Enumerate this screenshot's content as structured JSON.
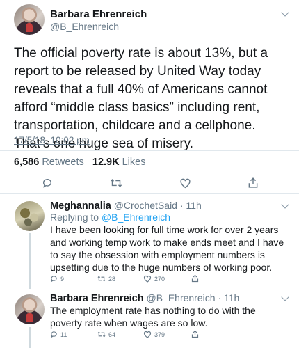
{
  "main_tweet": {
    "author_name": "Barbara Ehrenreich",
    "author_handle": "@B_Ehrenreich",
    "text": "The official poverty rate is about 13%, but a report to be released by United Way today reveals that a full 40% of Americans cannot afford “middle class basics” including rent, transportation, childcare and a cellphone. That’s one huge sea of misery.",
    "timestamp": "17/5/18, 10:02 pm",
    "retweets_count": "6,586",
    "retweets_label": "Retweets",
    "likes_count": "12.9K",
    "likes_label": "Likes"
  },
  "replies": [
    {
      "author_name": "Meghannalia",
      "author_handle": "@CrochetSaid",
      "time": "· 11h",
      "replying_prefix": "Replying to",
      "replying_to": "@B_Ehrenreich",
      "text": "I have been looking for full time work for over 2 years and working temp work to make ends meet and I have to say the obsession with employment numbers is upsetting due to the huge numbers of working poor.",
      "reply_count": "9",
      "retweet_count": "28",
      "like_count": "270"
    },
    {
      "author_name": "Barbara Ehrenreich",
      "author_handle": "@B_Ehrenreich",
      "time": "· 11h",
      "text": "The employment rate has nothing to do with the poverty rate when wages are so low.",
      "reply_count": "11",
      "retweet_count": "64",
      "like_count": "379"
    }
  ],
  "colors": {
    "link_blue": "#1da1f2",
    "secondary_text": "#657786",
    "divider": "#e1e8ed"
  }
}
